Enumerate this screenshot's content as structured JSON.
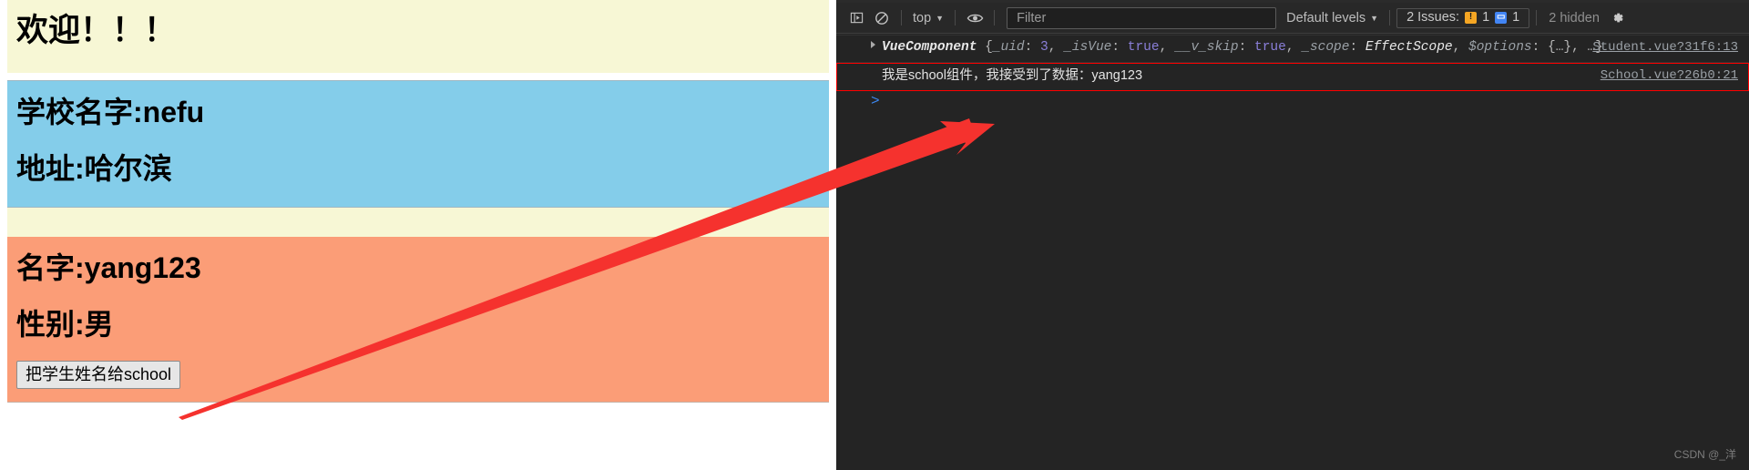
{
  "page": {
    "welcome": {
      "heading": "欢迎！！！"
    },
    "school": {
      "name_line": "学校名字:nefu",
      "address_line": "地址:哈尔滨"
    },
    "student": {
      "name_line": "名字:yang123",
      "gender_line": "性别:男",
      "button_label": "把学生姓名给school"
    },
    "colors": {
      "welcome_bg": "#f7f7d5",
      "school_bg": "#84cdea",
      "student_bg": "#fb9d77",
      "button_bg": "#e6e6e6"
    }
  },
  "devtools": {
    "toolbar": {
      "sidebar_toggle_icon": "show-console-sidebar-icon",
      "clear_console_icon": "clear-console-icon",
      "context_selector": "top",
      "context_caret": "▼",
      "eye_icon": "live-expression-eye-icon",
      "filter_placeholder": "Filter",
      "filter_value": "",
      "levels_label": "Default levels",
      "levels_caret": "▼",
      "issues_label": "2 Issues:",
      "issues_warning_count": "1",
      "issues_info_count": "1",
      "hidden_label": "2 hidden",
      "settings_icon": "gear-icon"
    },
    "console_rows": [
      {
        "type": "object",
        "expander": "▶",
        "object_name": "VueComponent",
        "parts": [
          {
            "t": "brace",
            "v": "{"
          },
          {
            "t": "key",
            "v": "_uid"
          },
          {
            "t": "plain",
            "v": ": "
          },
          {
            "t": "num",
            "v": "3"
          },
          {
            "t": "plain",
            "v": ", "
          },
          {
            "t": "key",
            "v": "_isVue"
          },
          {
            "t": "plain",
            "v": ": "
          },
          {
            "t": "bool",
            "v": "true"
          },
          {
            "t": "plain",
            "v": ", "
          },
          {
            "t": "key",
            "v": "__v_skip"
          },
          {
            "t": "plain",
            "v": ": "
          },
          {
            "t": "bool",
            "v": "true"
          },
          {
            "t": "plain",
            "v": ", "
          },
          {
            "t": "key",
            "v": "_scope"
          },
          {
            "t": "plain",
            "v": ": "
          },
          {
            "t": "cls",
            "v": "EffectScope"
          },
          {
            "t": "plain",
            "v": ", "
          },
          {
            "t": "key",
            "v": "$options"
          },
          {
            "t": "plain",
            "v": ": "
          },
          {
            "t": "brace",
            "v": "{…}"
          },
          {
            "t": "plain",
            "v": ", "
          },
          {
            "t": "brace",
            "v": "…}"
          }
        ],
        "source": "Student.vue?31f6:13",
        "highlighted": false
      },
      {
        "type": "text",
        "message": "我是school组件，我接受到了数据：yang123",
        "source": "School.vue?26b0:21",
        "highlighted": true
      }
    ],
    "prompt_caret": ">",
    "watermark": "CSDN @_洋"
  },
  "annotation": {
    "arrow_color": "#f5322e",
    "highlight_box_color": "#ff0000"
  }
}
